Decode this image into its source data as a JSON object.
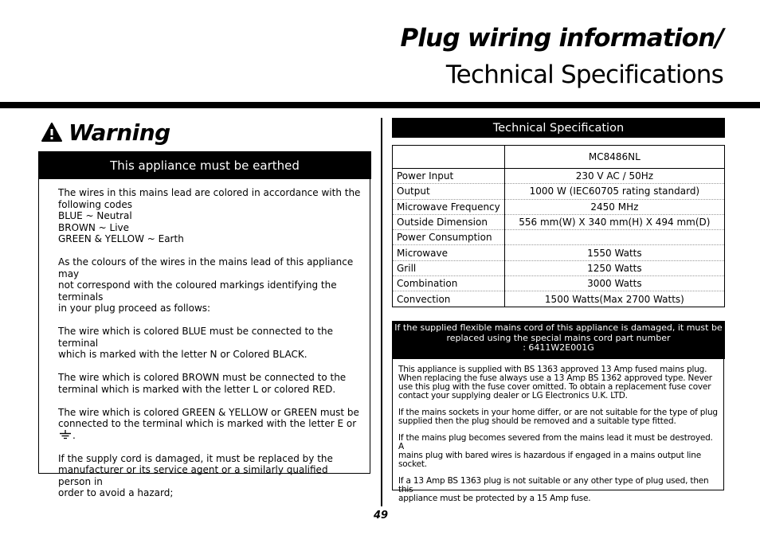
{
  "header": {
    "title_line1": "Plug wiring information/",
    "title_line2": "Technical Specifications"
  },
  "warning": {
    "icon": "warning-triangle-icon",
    "heading": "Warning",
    "band_label": "This appliance must be earthed",
    "paragraphs": [
      [
        "The wires in this mains lead are colored in accordance with the",
        "following codes",
        "BLUE ~ Neutral",
        "BROWN ~ Live",
        "GREEN & YELLOW ~ Earth"
      ],
      [
        "As the colours of the wires in the mains lead of this appliance may",
        "not correspond with the coloured markings identifying the  terminals",
        "in your plug proceed as follows:"
      ],
      [
        "The wire which is colored BLUE must be connected to the terminal",
        "which is marked with the letter N or Colored BLACK."
      ],
      [
        "The wire which is colored BROWN must be connected to the",
        "terminal which is marked with the letter L or colored RED."
      ],
      [
        "The wire which is colored GREEN & YELLOW or GREEN must be",
        "connected to the terminal which is marked with the letter E or"
      ],
      [
        "If the supply cord is damaged, it must be replaced by the",
        "manufacturer or its service agent or a similarly qualified person in",
        "order to avoid a hazard;"
      ]
    ],
    "earth_symbol": "earth-ground-icon",
    "earth_suffix": "."
  },
  "spec": {
    "band_label": "Technical Specification",
    "model": "MC8486NL",
    "rows": [
      {
        "label": "Power Input",
        "value": "230 V AC / 50Hz"
      },
      {
        "label": "Output",
        "value": "1000 W (IEC60705 rating standard)"
      },
      {
        "label": "Microwave Frequency",
        "value": "2450 MHz"
      },
      {
        "label": "Outside Dimension",
        "value": "556 mm(W) X 340 mm(H) X 494 mm(D)"
      },
      {
        "label": "Power Consumption",
        "value": ""
      },
      {
        "label": "Microwave",
        "value": "1550 Watts"
      },
      {
        "label": "Grill",
        "value": "1250 Watts"
      },
      {
        "label": "Combination",
        "value": "3000 Watts"
      },
      {
        "label": "Convection",
        "value": "1500 Watts(Max 2700 Watts)"
      }
    ]
  },
  "notice": {
    "band_lines": [
      "If the supplied flexible mains cord of this appliance is damaged, it must be",
      "replaced using the special mains cord part number",
      ": 6411W2E001G"
    ],
    "paragraphs": [
      [
        "This appliance is supplied with BS 1363 approved 13 Amp fused mains plug.",
        "When replacing the fuse always use a 13 Amp BS 1362 approved type. Never",
        "use this plug with the fuse cover omitted. To obtain  a replacement fuse cover",
        "contact your supplying dealer or LG Electronics U.K. LTD."
      ],
      [
        "If the mains sockets in your home differ, or are not suitable for the type of plug",
        "supplied then the plug should be removed and a suitable type fitted."
      ],
      [
        "If the mains plug becomes severed from the mains lead it must be destroyed. A",
        "mains plug with bared wires is hazardous if engaged in a mains output line socket."
      ],
      [
        "If a 13 Amp BS 1363 plug is not suitable or any other type of plug used, then this",
        "appliance must be protected by a 15 Amp fuse."
      ]
    ]
  },
  "footer": {
    "page_number": "49"
  }
}
